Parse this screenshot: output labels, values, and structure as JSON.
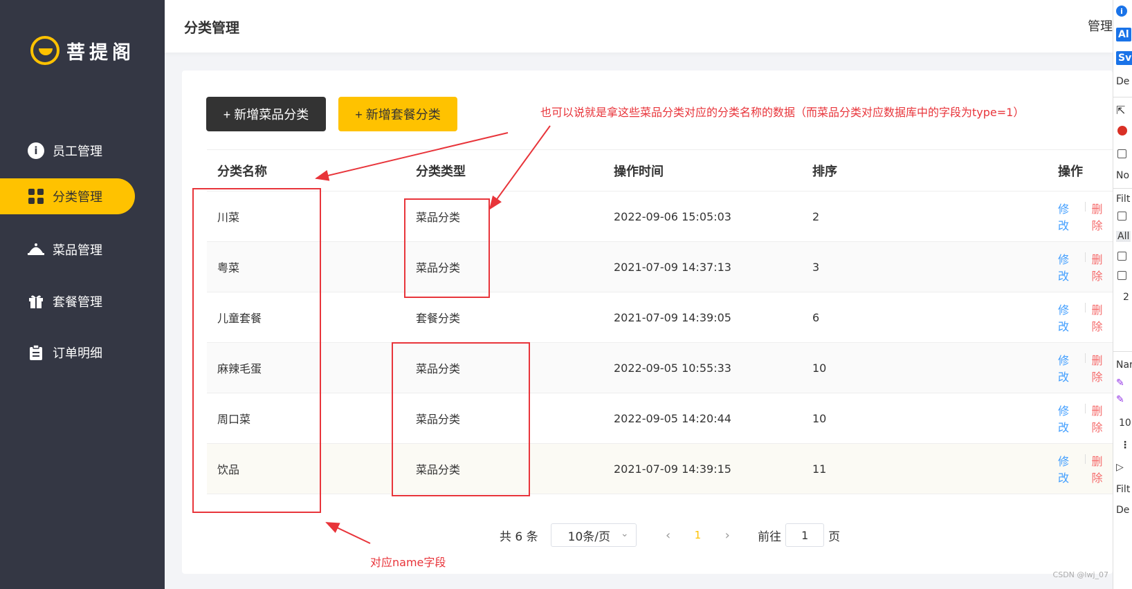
{
  "brand": {
    "logo_text": "菩提阁"
  },
  "sidebar": {
    "items": [
      {
        "label": "员工管理",
        "icon": "info-icon"
      },
      {
        "label": "分类管理",
        "icon": "grid-icon",
        "active": true
      },
      {
        "label": "菜品管理",
        "icon": "cloche-icon"
      },
      {
        "label": "套餐管理",
        "icon": "gift-icon"
      },
      {
        "label": "订单明细",
        "icon": "clipboard-icon"
      }
    ]
  },
  "header": {
    "title": "分类管理",
    "right_text": "管理"
  },
  "toolbar": {
    "add_dish_category": "+ 新增菜品分类",
    "add_setmeal_category": "+ 新增套餐分类"
  },
  "table": {
    "headers": [
      "分类名称",
      "分类类型",
      "操作时间",
      "排序",
      "操作"
    ],
    "rows": [
      {
        "name": "川菜",
        "type": "菜品分类",
        "time": "2022-09-06 15:05:03",
        "sort": "2"
      },
      {
        "name": "粤菜",
        "type": "菜品分类",
        "time": "2021-07-09 14:37:13",
        "sort": "3"
      },
      {
        "name": "儿童套餐",
        "type": "套餐分类",
        "time": "2021-07-09 14:39:05",
        "sort": "6"
      },
      {
        "name": "麻辣毛蛋",
        "type": "菜品分类",
        "time": "2022-09-05 10:55:33",
        "sort": "10"
      },
      {
        "name": "周口菜",
        "type": "菜品分类",
        "time": "2022-09-05 14:20:44",
        "sort": "10"
      },
      {
        "name": "饮品",
        "type": "菜品分类",
        "time": "2021-07-09 14:39:15",
        "sort": "11"
      }
    ],
    "edit_label": "修改",
    "delete_label": "删除"
  },
  "pagination": {
    "total_text": "共 6 条",
    "page_size": "10条/页",
    "current_page": "1",
    "goto_label": "前往",
    "goto_value": "1",
    "page_suffix": "页"
  },
  "annotations": {
    "top_note": "也可以说就是拿这些菜品分类对应的分类名称的数据（而菜品分类对应数据库中的字段为type=1）",
    "bottom_note": "对应name字段",
    "color": "#e8343a"
  },
  "devtools": {
    "labels": [
      "i",
      "Al",
      "Sv",
      "De",
      "No",
      "Filt",
      "All",
      "2",
      "Nar",
      "10",
      "Filt",
      "De"
    ]
  },
  "watermark": "CSDN @lwj_07",
  "colors": {
    "sidebar_bg": "#343744",
    "accent": "#ffc200",
    "link": "#419eff",
    "danger": "#f56c6c"
  }
}
